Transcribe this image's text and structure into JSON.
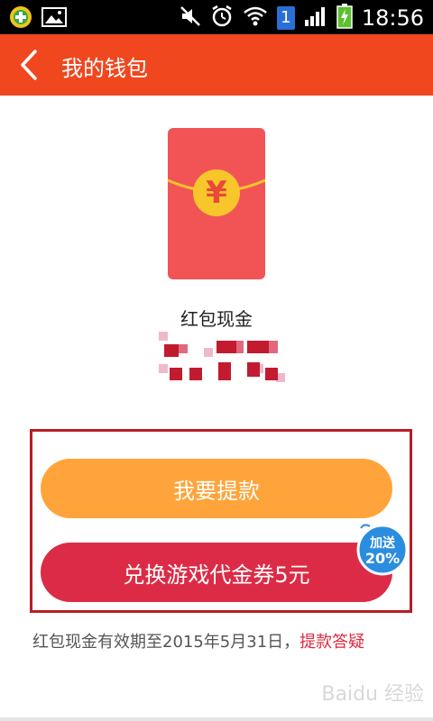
{
  "status_bar": {
    "time": "18:56",
    "sim_badge": "1",
    "icons": [
      "app-icon",
      "image-icon",
      "mute-icon",
      "alarm-icon",
      "wifi-icon",
      "sim-icon",
      "signal-icon",
      "battery-charging-icon"
    ]
  },
  "app_bar": {
    "title": "我的钱包",
    "back_icon": "chevron-left-icon"
  },
  "wallet": {
    "envelope_symbol": "¥",
    "label": "红包现金",
    "amount_pixelated": true
  },
  "actions": {
    "withdraw_label": "我要提款",
    "exchange_label": "兑换游戏代金券5元",
    "badge_top": "加送",
    "badge_bottom": "20%"
  },
  "note": {
    "text": "红包现金有效期至2015年5月31日，",
    "link": "提款答疑"
  },
  "watermark": "Baidu 经验",
  "colors": {
    "appbar": "#f0471f",
    "withdraw": "#ffa43a",
    "exchange": "#dc2b46",
    "envelope": "#f25456",
    "coin": "#f6c62a",
    "link": "#e0283e"
  }
}
